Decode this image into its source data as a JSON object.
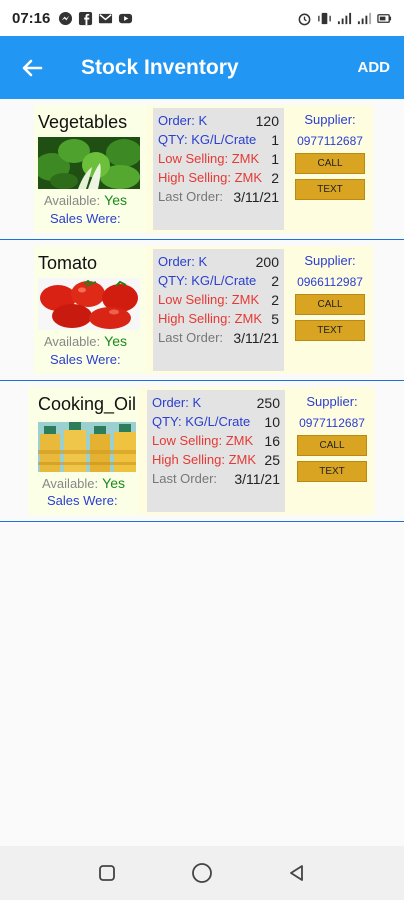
{
  "status": {
    "time": "07:16"
  },
  "appbar": {
    "title": "Stock Inventory",
    "add_label": "ADD"
  },
  "items": [
    {
      "name": "Vegetables",
      "available_label": "Available:",
      "available_value": "Yes",
      "sales_label": "Sales Were:",
      "order_label": "Order: K",
      "order_value": "120",
      "qty_label": "QTY: KG/L/Crate",
      "qty_value": "1",
      "low_label": "Low Selling: ZMK",
      "low_value": "1",
      "high_label": "High Selling: ZMK",
      "high_value": "2",
      "last_label": "Last Order:",
      "last_value": "3/11/21",
      "supplier_label": "Supplier:",
      "supplier_phone": "0977112687",
      "call_label": "CALL",
      "text_label": "TEXT"
    },
    {
      "name": "Tomato",
      "available_label": "Available:",
      "available_value": "Yes",
      "sales_label": "Sales Were:",
      "order_label": "Order: K",
      "order_value": "200",
      "qty_label": "QTY: KG/L/Crate",
      "qty_value": "2",
      "low_label": "Low Selling: ZMK",
      "low_value": "2",
      "high_label": "High Selling: ZMK",
      "high_value": "5",
      "last_label": "Last Order:",
      "last_value": "3/11/21",
      "supplier_label": "Supplier:",
      "supplier_phone": "0966112987",
      "call_label": "CALL",
      "text_label": "TEXT"
    },
    {
      "name": "Cooking_Oil",
      "available_label": "Available:",
      "available_value": "Yes",
      "sales_label": "Sales Were:",
      "order_label": "Order: K",
      "order_value": "250",
      "qty_label": "QTY: KG/L/Crate",
      "qty_value": "10",
      "low_label": "Low Selling: ZMK",
      "low_value": "16",
      "high_label": "High Selling: ZMK",
      "high_value": "25",
      "last_label": "Last Order:",
      "last_value": "3/11/21",
      "supplier_label": "Supplier:",
      "supplier_phone": "0977112687",
      "call_label": "CALL",
      "text_label": "TEXT"
    }
  ]
}
